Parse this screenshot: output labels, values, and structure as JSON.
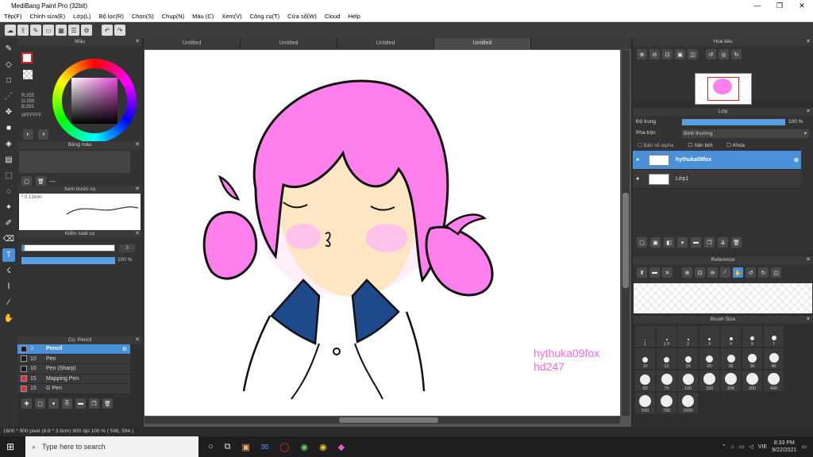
{
  "window": {
    "title": "MediBang Paint Pro (32bit)"
  },
  "menu": [
    "Tệp(F)",
    "Chỉnh sửa(E)",
    "Lớp(L)",
    "Bộ lọc(R)",
    "Chọn(S)",
    "Chụp(N)",
    "Màu (C)",
    "Xem(V)",
    "Công cụ(T)",
    "Cửa sổ(W)",
    "Cloud",
    "Help"
  ],
  "tabs": [
    "Untitled",
    "Untitled",
    "Untitled",
    "Untitled"
  ],
  "left": {
    "color_title": "Màu",
    "rgb": [
      "R:255",
      "G:255",
      "B:255"
    ],
    "hex": "#FFFFFF",
    "palette_title": "Bảng màu",
    "palette_dash": "---",
    "preview_title": "Xem trước cọ",
    "preview_size": "* 0.13mm",
    "control_title": "Kiểm soát cọ",
    "size_value": "3",
    "opacity_value": "100 %",
    "brush_title": "Cọ: Pencil",
    "brushes": [
      {
        "size": "3",
        "name": "Pencil",
        "color": "#1a1a1a"
      },
      {
        "size": "10",
        "name": "Pen",
        "color": "#1a1a1a"
      },
      {
        "size": "10",
        "name": "Pen (Sharp)",
        "color": "#1a1a1a"
      },
      {
        "size": "15",
        "name": "Mapping Pen",
        "color": "#e03030"
      },
      {
        "size": "15",
        "name": "G Pen",
        "color": "#e03030"
      }
    ]
  },
  "right": {
    "nav_title": "Hoa tiêu",
    "layer_title": "Lớp",
    "opacity_label": "Độ trong",
    "opacity_value": "100 %",
    "blend_label": "Pha trộn",
    "blend_value": "Bình thường",
    "alpha_label": "Bản vẽ alpha",
    "clip_label": "Xén bớt",
    "lock_label": "Khóa",
    "layers": [
      "hythuka09fox",
      "Lớp1"
    ],
    "reference_title": "Reference",
    "brushsize_title": "Brush Size",
    "sizes": [
      "1",
      "1.5",
      "2",
      "3",
      "4",
      "5",
      "7",
      "10",
      "12",
      "15",
      "20",
      "25",
      "30",
      "40",
      "50",
      "70",
      "100",
      "150",
      "200",
      "300",
      "400",
      "500",
      "700",
      "1000"
    ]
  },
  "canvas": {
    "watermark_1": "hythuka09fox",
    "watermark_2": "hd247",
    "watermark_color": "#ff66dd",
    "hair_color": "#ff80ec",
    "collar_color": "#1e4a8c"
  },
  "status": "1600 * 900 pixel   (6.8 * 3.8cm)   600 dpi   100 %   ( 596, 594 )",
  "taskbar": {
    "search_placeholder": "Type here to search",
    "lang": "VIE",
    "time": "8:33 PM",
    "date": "9/22/2021"
  }
}
